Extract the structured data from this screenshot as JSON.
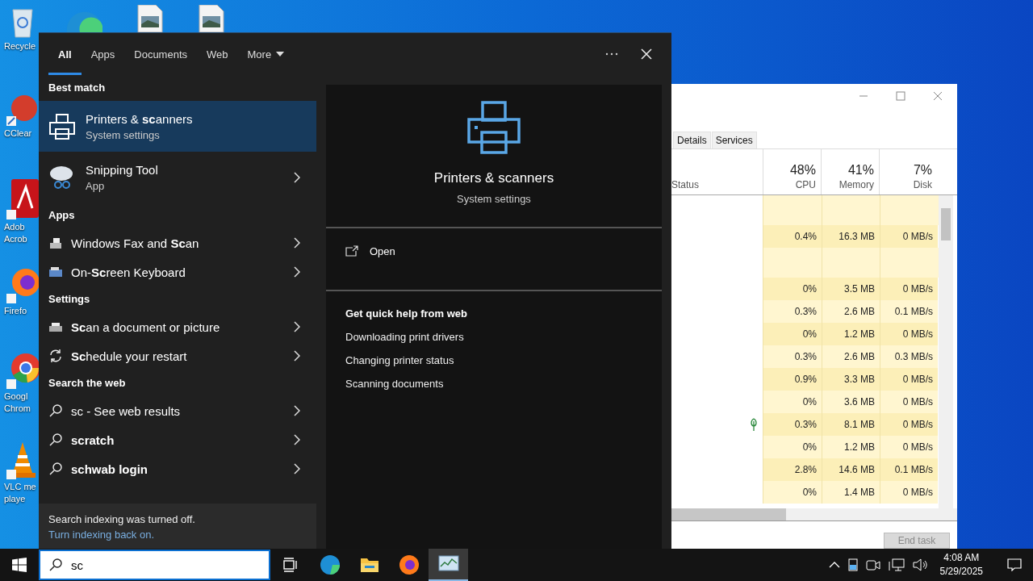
{
  "desktop_icons": [
    {
      "kind": "recycle",
      "label_lines": [
        "Recycle"
      ]
    },
    {
      "kind": "edge"
    },
    {
      "kind": "file"
    },
    {
      "kind": "file"
    },
    {
      "kind": "ccleaner",
      "label_lines": [
        "CClear"
      ]
    },
    {
      "kind": "acrobat",
      "label_lines": [
        "Adob",
        "Acrob"
      ]
    },
    {
      "kind": "firefox",
      "label_lines": [
        "Firefo"
      ]
    },
    {
      "kind": "chrome",
      "label_lines": [
        "Googl",
        "Chrom"
      ]
    },
    {
      "kind": "vlc",
      "label_lines": [
        "VLC me",
        "playe"
      ]
    }
  ],
  "task_manager": {
    "tabs": [
      {
        "label": "Details",
        "selected": false
      },
      {
        "label": "Services",
        "selected": false
      }
    ],
    "columns": [
      {
        "label": "Status"
      },
      {
        "label": "CPU",
        "total": "48%"
      },
      {
        "label": "Memory",
        "total": "41%"
      },
      {
        "label": "Disk",
        "total": "7%"
      }
    ],
    "rows": [
      {
        "kind": "group",
        "efficiency_mode": false,
        "cells": []
      },
      {
        "kind": "process",
        "efficiency_mode": false,
        "cells": [
          "",
          "0.4%",
          "16.3 MB",
          "0 MB/s"
        ]
      },
      {
        "kind": "group",
        "efficiency_mode": false,
        "cells": []
      },
      {
        "kind": "process",
        "efficiency_mode": false,
        "cells": [
          "",
          "0%",
          "3.5 MB",
          "0 MB/s"
        ]
      },
      {
        "kind": "process",
        "efficiency_mode": false,
        "cells": [
          "",
          "0.3%",
          "2.6 MB",
          "0.1 MB/s"
        ]
      },
      {
        "kind": "process",
        "efficiency_mode": false,
        "cells": [
          "",
          "0%",
          "1.2 MB",
          "0 MB/s"
        ]
      },
      {
        "kind": "process",
        "efficiency_mode": false,
        "cells": [
          "",
          "0.3%",
          "2.6 MB",
          "0.3 MB/s"
        ]
      },
      {
        "kind": "process",
        "efficiency_mode": false,
        "cells": [
          "",
          "0.9%",
          "3.3 MB",
          "0 MB/s"
        ]
      },
      {
        "kind": "process",
        "efficiency_mode": false,
        "cells": [
          "",
          "0%",
          "3.6 MB",
          "0 MB/s"
        ]
      },
      {
        "kind": "process",
        "efficiency_mode": true,
        "cells": [
          "",
          "0.3%",
          "8.1 MB",
          "0 MB/s"
        ]
      },
      {
        "kind": "process",
        "efficiency_mode": false,
        "cells": [
          "",
          "0%",
          "1.2 MB",
          "0 MB/s"
        ]
      },
      {
        "kind": "process",
        "efficiency_mode": false,
        "cells": [
          "",
          "2.8%",
          "14.6 MB",
          "0.1 MB/s"
        ]
      },
      {
        "kind": "process",
        "efficiency_mode": false,
        "cells": [
          "",
          "0%",
          "1.4 MB",
          "0 MB/s"
        ]
      }
    ],
    "end_task": {
      "label": "End task",
      "disabled": true
    }
  },
  "search": {
    "tabs": [
      {
        "label": "All",
        "selected": true,
        "dropdown": false
      },
      {
        "label": "Apps",
        "selected": false,
        "dropdown": false
      },
      {
        "label": "Documents",
        "selected": false,
        "dropdown": false
      },
      {
        "label": "Web",
        "selected": false,
        "dropdown": false
      },
      {
        "label": "More",
        "selected": false,
        "dropdown": true
      }
    ],
    "sections": [
      {
        "heading": "Best match",
        "items": [
          {
            "kind": "printer",
            "title": "Printers & **sc**anners",
            "subtitle": "System settings",
            "selected": true,
            "arrow": false
          },
          {
            "kind": "snip",
            "title": "Snipping Tool",
            "subtitle": "App",
            "selected": false,
            "arrow": true
          }
        ]
      },
      {
        "heading": "Apps",
        "items": [
          {
            "kind": "fax",
            "title": "Windows Fax and **Sc**an",
            "selected": false,
            "arrow": true
          },
          {
            "kind": "keyboard",
            "title": "On-**Sc**reen Keyboard",
            "selected": false,
            "arrow": true
          }
        ]
      },
      {
        "heading": "Settings",
        "items": [
          {
            "kind": "scanner",
            "title": "**Sc**an a document or picture",
            "selected": false,
            "arrow": true
          },
          {
            "kind": "restart",
            "title": "**Sc**hedule your restart",
            "selected": false,
            "arrow": true
          }
        ]
      },
      {
        "heading": "Search the web",
        "items": [
          {
            "kind": "web",
            "title": "sc - See web results",
            "selected": false,
            "arrow": true
          },
          {
            "kind": "suggestion",
            "title": "scratch",
            "selected": false,
            "arrow": true
          },
          {
            "kind": "suggestion",
            "title": "schwab login",
            "selected": false,
            "arrow": true
          }
        ]
      }
    ],
    "footer": {
      "message": "Search indexing was turned off.",
      "link": "Turn indexing back on."
    },
    "preview": {
      "title": "Printers & scanners",
      "subtitle": "System settings",
      "action": "Open",
      "help_heading": "Get quick help from web",
      "help_links": [
        "Downloading print drivers",
        "Changing printer status",
        "Scanning documents"
      ]
    }
  },
  "taskbar": {
    "search_value": "sc",
    "apps": [
      {
        "kind": "taskview",
        "active": false
      },
      {
        "kind": "edge",
        "active": false
      },
      {
        "kind": "explorer",
        "active": false
      },
      {
        "kind": "firefox",
        "active": false
      },
      {
        "kind": "taskmgr",
        "active": true
      }
    ],
    "time": "4:08 AM",
    "date": "5/29/2025"
  }
}
